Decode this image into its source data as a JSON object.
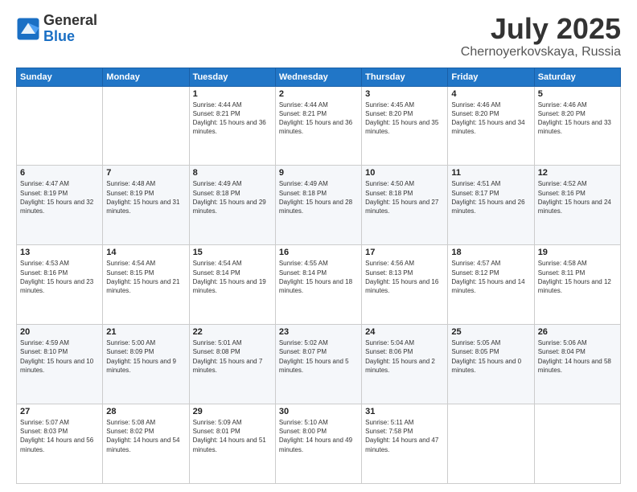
{
  "logo": {
    "general": "General",
    "blue": "Blue"
  },
  "title": {
    "month": "July 2025",
    "location": "Chernoyerkovskaya, Russia"
  },
  "weekdays": [
    "Sunday",
    "Monday",
    "Tuesday",
    "Wednesday",
    "Thursday",
    "Friday",
    "Saturday"
  ],
  "weeks": [
    [
      {
        "day": "",
        "info": ""
      },
      {
        "day": "",
        "info": ""
      },
      {
        "day": "1",
        "info": "Sunrise: 4:44 AM\nSunset: 8:21 PM\nDaylight: 15 hours and 36 minutes."
      },
      {
        "day": "2",
        "info": "Sunrise: 4:44 AM\nSunset: 8:21 PM\nDaylight: 15 hours and 36 minutes."
      },
      {
        "day": "3",
        "info": "Sunrise: 4:45 AM\nSunset: 8:20 PM\nDaylight: 15 hours and 35 minutes."
      },
      {
        "day": "4",
        "info": "Sunrise: 4:46 AM\nSunset: 8:20 PM\nDaylight: 15 hours and 34 minutes."
      },
      {
        "day": "5",
        "info": "Sunrise: 4:46 AM\nSunset: 8:20 PM\nDaylight: 15 hours and 33 minutes."
      }
    ],
    [
      {
        "day": "6",
        "info": "Sunrise: 4:47 AM\nSunset: 8:19 PM\nDaylight: 15 hours and 32 minutes."
      },
      {
        "day": "7",
        "info": "Sunrise: 4:48 AM\nSunset: 8:19 PM\nDaylight: 15 hours and 31 minutes."
      },
      {
        "day": "8",
        "info": "Sunrise: 4:49 AM\nSunset: 8:18 PM\nDaylight: 15 hours and 29 minutes."
      },
      {
        "day": "9",
        "info": "Sunrise: 4:49 AM\nSunset: 8:18 PM\nDaylight: 15 hours and 28 minutes."
      },
      {
        "day": "10",
        "info": "Sunrise: 4:50 AM\nSunset: 8:18 PM\nDaylight: 15 hours and 27 minutes."
      },
      {
        "day": "11",
        "info": "Sunrise: 4:51 AM\nSunset: 8:17 PM\nDaylight: 15 hours and 26 minutes."
      },
      {
        "day": "12",
        "info": "Sunrise: 4:52 AM\nSunset: 8:16 PM\nDaylight: 15 hours and 24 minutes."
      }
    ],
    [
      {
        "day": "13",
        "info": "Sunrise: 4:53 AM\nSunset: 8:16 PM\nDaylight: 15 hours and 23 minutes."
      },
      {
        "day": "14",
        "info": "Sunrise: 4:54 AM\nSunset: 8:15 PM\nDaylight: 15 hours and 21 minutes."
      },
      {
        "day": "15",
        "info": "Sunrise: 4:54 AM\nSunset: 8:14 PM\nDaylight: 15 hours and 19 minutes."
      },
      {
        "day": "16",
        "info": "Sunrise: 4:55 AM\nSunset: 8:14 PM\nDaylight: 15 hours and 18 minutes."
      },
      {
        "day": "17",
        "info": "Sunrise: 4:56 AM\nSunset: 8:13 PM\nDaylight: 15 hours and 16 minutes."
      },
      {
        "day": "18",
        "info": "Sunrise: 4:57 AM\nSunset: 8:12 PM\nDaylight: 15 hours and 14 minutes."
      },
      {
        "day": "19",
        "info": "Sunrise: 4:58 AM\nSunset: 8:11 PM\nDaylight: 15 hours and 12 minutes."
      }
    ],
    [
      {
        "day": "20",
        "info": "Sunrise: 4:59 AM\nSunset: 8:10 PM\nDaylight: 15 hours and 10 minutes."
      },
      {
        "day": "21",
        "info": "Sunrise: 5:00 AM\nSunset: 8:09 PM\nDaylight: 15 hours and 9 minutes."
      },
      {
        "day": "22",
        "info": "Sunrise: 5:01 AM\nSunset: 8:08 PM\nDaylight: 15 hours and 7 minutes."
      },
      {
        "day": "23",
        "info": "Sunrise: 5:02 AM\nSunset: 8:07 PM\nDaylight: 15 hours and 5 minutes."
      },
      {
        "day": "24",
        "info": "Sunrise: 5:04 AM\nSunset: 8:06 PM\nDaylight: 15 hours and 2 minutes."
      },
      {
        "day": "25",
        "info": "Sunrise: 5:05 AM\nSunset: 8:05 PM\nDaylight: 15 hours and 0 minutes."
      },
      {
        "day": "26",
        "info": "Sunrise: 5:06 AM\nSunset: 8:04 PM\nDaylight: 14 hours and 58 minutes."
      }
    ],
    [
      {
        "day": "27",
        "info": "Sunrise: 5:07 AM\nSunset: 8:03 PM\nDaylight: 14 hours and 56 minutes."
      },
      {
        "day": "28",
        "info": "Sunrise: 5:08 AM\nSunset: 8:02 PM\nDaylight: 14 hours and 54 minutes."
      },
      {
        "day": "29",
        "info": "Sunrise: 5:09 AM\nSunset: 8:01 PM\nDaylight: 14 hours and 51 minutes."
      },
      {
        "day": "30",
        "info": "Sunrise: 5:10 AM\nSunset: 8:00 PM\nDaylight: 14 hours and 49 minutes."
      },
      {
        "day": "31",
        "info": "Sunrise: 5:11 AM\nSunset: 7:58 PM\nDaylight: 14 hours and 47 minutes."
      },
      {
        "day": "",
        "info": ""
      },
      {
        "day": "",
        "info": ""
      }
    ]
  ]
}
